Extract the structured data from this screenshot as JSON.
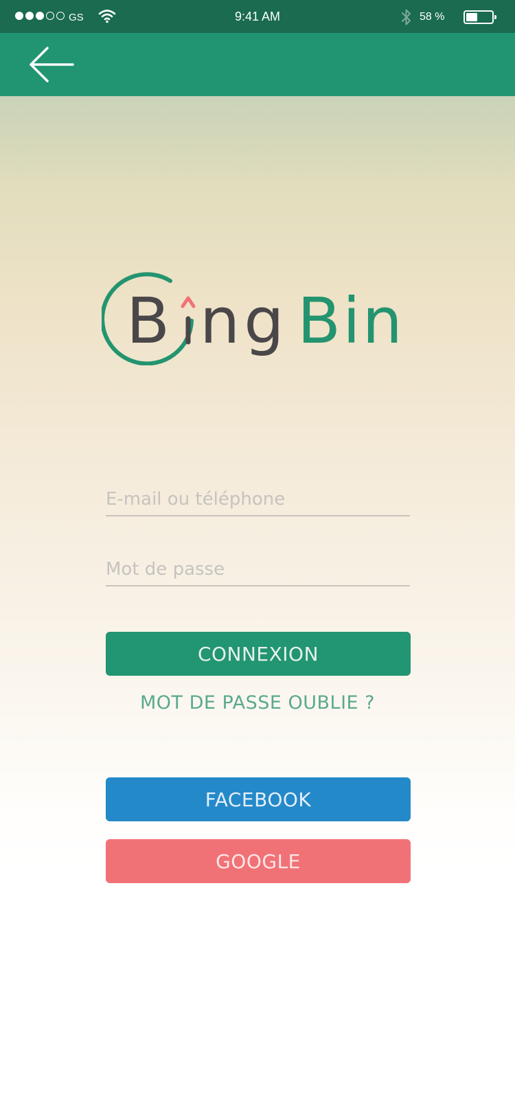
{
  "status_bar": {
    "carrier": "GS",
    "time": "9:41 AM",
    "battery": "58 %",
    "signal_strength": 3,
    "signal_max": 5
  },
  "nav": {
    "back_icon": "arrow-left-icon"
  },
  "logo": {
    "part1_letter": "B",
    "part1_rest": "ng",
    "part2": "Bin",
    "colors": {
      "ring": "#23946f",
      "dark_text": "#4a474a",
      "green_text": "#23946f",
      "arrow": "#f17276"
    }
  },
  "form": {
    "email_placeholder": "E-mail ou téléphone",
    "password_placeholder": "Mot de passe",
    "connect_label": "CONNEXION",
    "forgot_label": "MOT DE PASSE OUBLIE ?"
  },
  "social": {
    "facebook_label": "FACEBOOK",
    "google_label": "GOOGLE"
  },
  "colors": {
    "status_bar": "#1a6b50",
    "nav_bar": "#219572",
    "connect_button": "#229572",
    "facebook_button": "#2489c9",
    "google_button": "#f17276",
    "forgot_link": "#5aa98d"
  }
}
